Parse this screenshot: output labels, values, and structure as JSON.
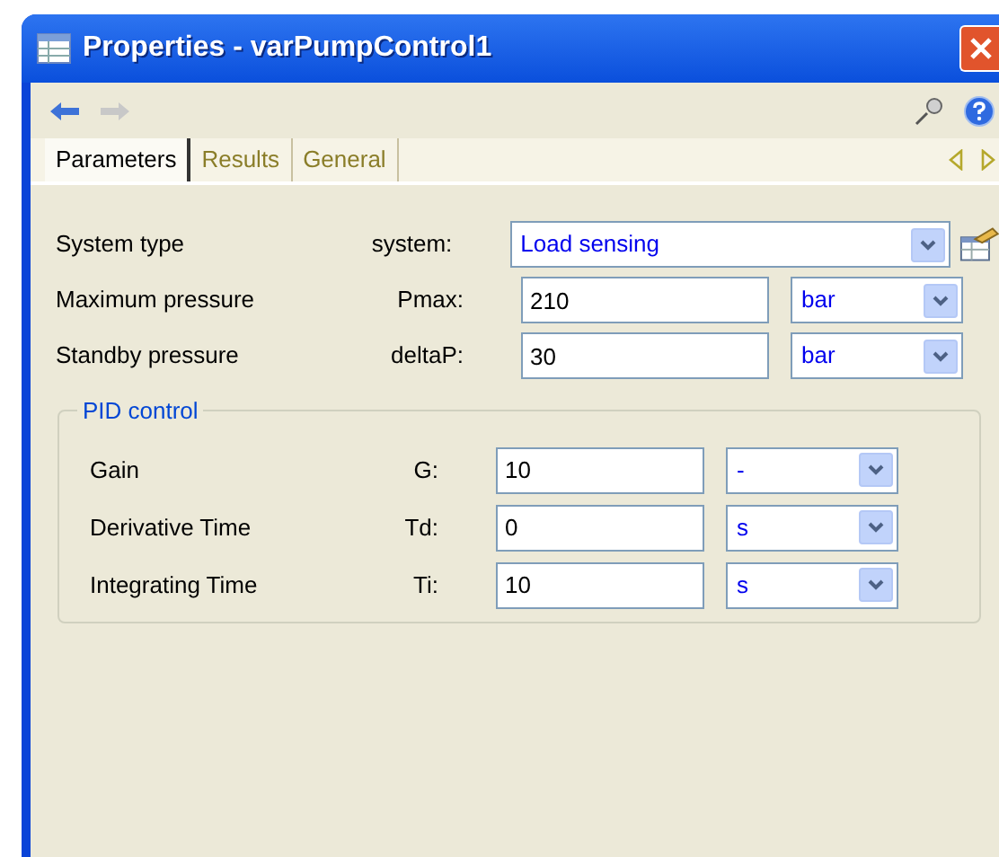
{
  "window": {
    "title": "Properties - varPumpControl1"
  },
  "tabs": [
    {
      "label": "Parameters",
      "selected": true
    },
    {
      "label": "Results",
      "selected": false
    },
    {
      "label": "General",
      "selected": false
    }
  ],
  "parameters": [
    {
      "label": "System type",
      "symbol": "system:",
      "kind": "choice",
      "value": "Load sensing"
    },
    {
      "label": "Maximum pressure",
      "symbol": "Pmax:",
      "kind": "number",
      "value": "210",
      "unit": "bar"
    },
    {
      "label": "Standby pressure",
      "symbol": "deltaP:",
      "kind": "number",
      "value": "30",
      "unit": "bar"
    }
  ],
  "pid_group": {
    "title": "PID control",
    "parameters": [
      {
        "label": "Gain",
        "symbol": "G:",
        "kind": "number",
        "value": "10",
        "unit": "-"
      },
      {
        "label": "Derivative Time",
        "symbol": "Td:",
        "kind": "number",
        "value": "0",
        "unit": "s"
      },
      {
        "label": "Integrating Time",
        "symbol": "Ti:",
        "kind": "number",
        "value": "10",
        "unit": "s"
      }
    ]
  }
}
